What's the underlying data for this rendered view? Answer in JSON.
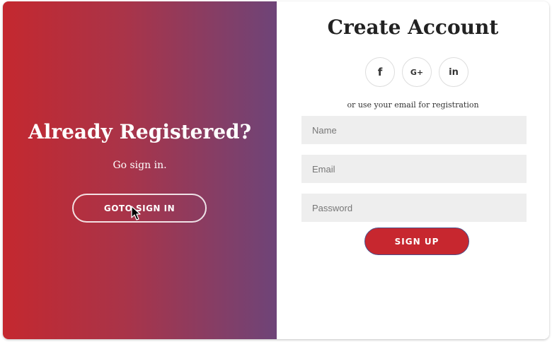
{
  "overlay": {
    "title": "Already Registered?",
    "text": "Go sign in.",
    "button_label": "GOTO SIGN IN"
  },
  "form": {
    "title": "Create Account",
    "social": [
      {
        "icon": "facebook-icon",
        "glyph": "f"
      },
      {
        "icon": "google-plus-icon",
        "glyph": "G+"
      },
      {
        "icon": "linkedin-icon",
        "glyph": "in"
      }
    ],
    "hint": "or use your email for registration",
    "fields": {
      "name_placeholder": "Name",
      "email_placeholder": "Email",
      "password_placeholder": "Password"
    },
    "submit_label": "SIGN UP"
  },
  "colors": {
    "gradient_start": "#c4282f",
    "gradient_end": "#6e4478",
    "accent": "#c7272f",
    "field_bg": "#eeeeee"
  }
}
